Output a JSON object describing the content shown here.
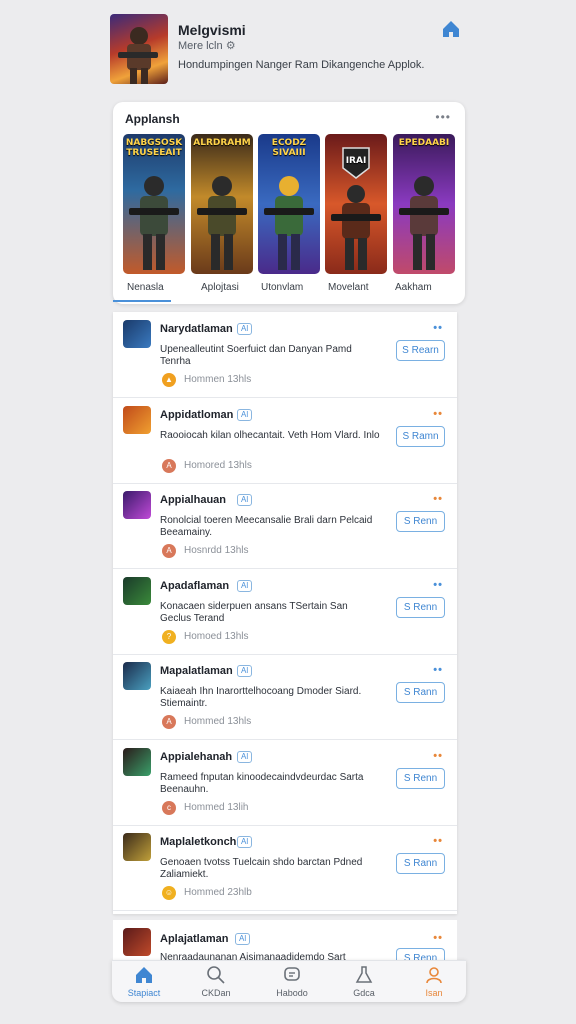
{
  "header": {
    "title": "Melgvismi",
    "subtitle": "Mere lcln",
    "description": "Hondumpingen Nanger Ram Dikangenche Applok."
  },
  "featured": {
    "title": "Applansh",
    "more": "•••",
    "tiles": [
      {
        "caption": "NABGSOSK TRUSEEAIT"
      },
      {
        "caption": "ALRDRAHM"
      },
      {
        "caption": "ECODZ SIVAIII"
      },
      {
        "caption": "IRAI"
      },
      {
        "caption": "EPEDAABI"
      }
    ],
    "categories": [
      "Nenasla",
      "Aplojtasi",
      "Utonvlam",
      "Movelant",
      "Aakham"
    ]
  },
  "apps": [
    {
      "name": "Narydatlaman",
      "tag": "Al",
      "desc": "Upenealleutint Soerfuict dan Danyan Pamd Tenrha",
      "meta": "Hommen 13hls",
      "button": "S Rearn",
      "dots_color": "#4a90d9",
      "meta_color": "#f0a020",
      "meta_glyph": "▲"
    },
    {
      "name": "Appidatloman",
      "tag": "Al",
      "desc": "Raooiocah kilan olhecantait. Veth Hom Vlard. Inlo",
      "meta": "Homored 13hls",
      "button": "S Ramn",
      "dots_color": "#e8873a",
      "meta_color": "#d8785a",
      "meta_glyph": "A"
    },
    {
      "name": "Appialhauan",
      "tag": "Al",
      "desc": "Ronolcial toeren Meecansalie Brali darn Pelcaid Beeamainy.",
      "meta": "Hosnrdd 13hls",
      "button": "S Renn",
      "dots_color": "#e8873a",
      "meta_color": "#d8785a",
      "meta_glyph": "A"
    },
    {
      "name": "Apadaflaman",
      "tag": "Al",
      "desc": "Konacaen siderpuen ansans TSertain San Geclus Terand",
      "meta": "Homoed 13hls",
      "button": "S Renn",
      "dots_color": "#4a90d9",
      "meta_color": "#f0b020",
      "meta_glyph": "?"
    },
    {
      "name": "Mapalatlaman",
      "tag": "Al",
      "desc": "Kaiaeah Ihn Inarorttelhocoang Dmoder Siard. Stiemaintr.",
      "meta": "Hommed 13hls",
      "button": "S Rann",
      "dots_color": "#4a90d9",
      "meta_color": "#d8785a",
      "meta_glyph": "A"
    },
    {
      "name": "Appialehanah",
      "tag": "Al",
      "desc": "Rameed fnputan kinoodecaindvdeurdac Sarta Beenauhn.",
      "meta": "Hommed 13lih",
      "button": "S Renn",
      "dots_color": "#e8873a",
      "meta_color": "#d8785a",
      "meta_glyph": "c"
    },
    {
      "name": "Maplaletkonch",
      "tag": "Al",
      "desc": "Genoaen tvotss Tuelcain shdo barctan Pdned Zaliamiekt.",
      "meta": "Hommed 23hlb",
      "button": "S Rann",
      "dots_color": "#e8873a",
      "meta_color": "#f0b020",
      "meta_glyph": "☺"
    },
    {
      "name": "Aplajatlaman",
      "tag": "Al",
      "desc": "Nenraadaunanan Aisimanaadidemdo Sart",
      "meta": "",
      "button": "S Renn",
      "dots_color": "#e8873a",
      "meta_color": "#d8785a",
      "meta_glyph": ""
    }
  ],
  "nav": [
    {
      "label": "Stapiact",
      "icon": "home-icon"
    },
    {
      "label": "CKDan",
      "icon": "search-icon"
    },
    {
      "label": "Habodo",
      "icon": "chat-icon"
    },
    {
      "label": "Gdca",
      "icon": "flask-icon"
    },
    {
      "label": "Isan",
      "icon": "profile-icon"
    }
  ]
}
